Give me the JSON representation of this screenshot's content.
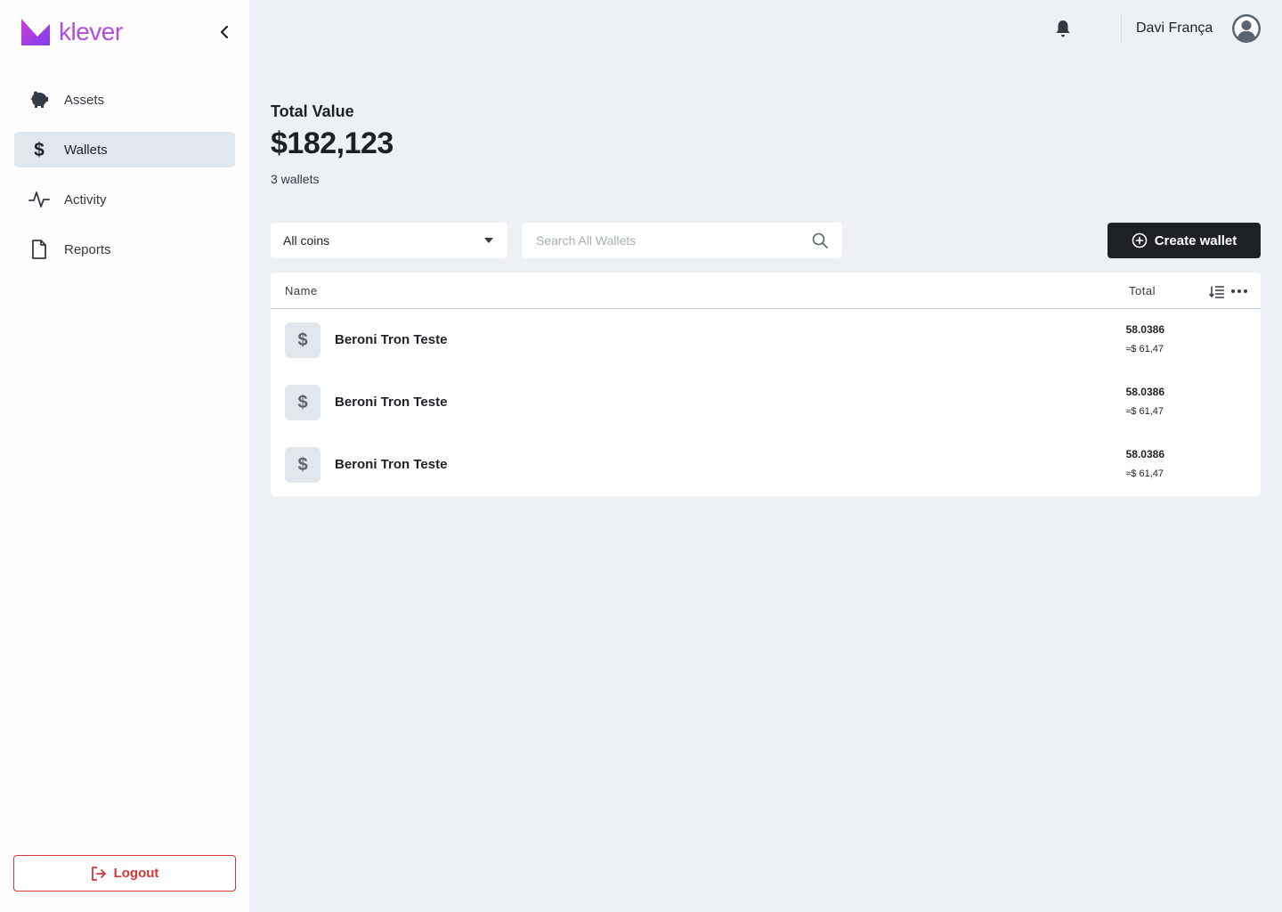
{
  "brand": {
    "name": "klever",
    "color": "#b04ee0"
  },
  "sidebar": {
    "collapse_icon": "chevron-left-icon",
    "items": [
      {
        "label": "Assets",
        "icon": "piggy-bank-icon",
        "active": false
      },
      {
        "label": "Wallets",
        "icon": "dollar-icon",
        "active": true
      },
      {
        "label": "Activity",
        "icon": "activity-pulse-icon",
        "active": false
      },
      {
        "label": "Reports",
        "icon": "document-icon",
        "active": false
      }
    ],
    "logout_label": "Logout",
    "logout_color": "#d7353a"
  },
  "header": {
    "user_name": "Davi França",
    "bell_icon": "bell-icon",
    "avatar_icon": "user-avatar-icon"
  },
  "summary": {
    "title": "Total Value",
    "value": "$182,123",
    "wallet_count": "3 wallets"
  },
  "controls": {
    "coin_filter": "All coins",
    "search_placeholder": "Search All Wallets",
    "create_label": "Create wallet",
    "create_bg": "#1d2125"
  },
  "table": {
    "columns": {
      "name": "Name",
      "total": "Total"
    },
    "rows": [
      {
        "icon": "$",
        "name": "Beroni Tron Teste",
        "amount": "58.0386",
        "fiat": "≈$ 61,47"
      },
      {
        "icon": "$",
        "name": "Beroni Tron Teste",
        "amount": "58.0386",
        "fiat": "≈$ 61,47"
      },
      {
        "icon": "$",
        "name": "Beroni Tron Teste",
        "amount": "58.0386",
        "fiat": "≈$ 61,47"
      }
    ]
  },
  "colors": {
    "background": "#edf1f5",
    "sidebar": "#fdfdfd",
    "active_item": "#e2e7ed"
  }
}
